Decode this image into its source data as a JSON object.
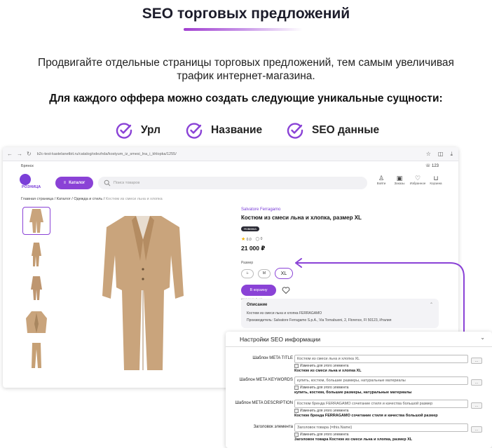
{
  "hero": {
    "title": "SEO торговых предложений",
    "subtitle": "Продвигайте отдельные страницы торговых предложений, тем самым увеличивая трафик интернет-магазина.",
    "heading": "Для каждого оффера можно создать следующие уникальные сущности:",
    "features": [
      {
        "label": "Урл",
        "icon": "check-circle-icon"
      },
      {
        "label": "Название",
        "icon": "check-circle-icon"
      },
      {
        "label": "SEO данные",
        "icon": "check-circle-icon"
      }
    ],
    "accent_color": "#8a42d6"
  },
  "browser": {
    "url": "b2c-test-kastelanetbit.ru/catalog/odezhda/kostyum_iz_smesi_lna_i_khlopka/1255/",
    "city": "Брянск",
    "phone": "☏ 123"
  },
  "store": {
    "logo_text": "РОЗНИЦА",
    "catalog_label": "Каталог",
    "search_placeholder": "Поиск товаров",
    "header_icons": [
      {
        "label": "Войти",
        "icon": "user-icon"
      },
      {
        "label": "Заказы",
        "icon": "box-icon"
      },
      {
        "label": "Избранное",
        "icon": "heart-icon"
      },
      {
        "label": "Корзина",
        "icon": "cart-icon"
      }
    ],
    "breadcrumbs": [
      "Главная страница",
      "Каталог",
      "Одежда и стиль"
    ],
    "breadcrumb_current": "Костюм из смеси льна и хлопка"
  },
  "product": {
    "brand": "Salvatore Ferragamo",
    "name": "Костюм из смеси льна и хлопка, размер XL",
    "badge": "Новинка",
    "rating": "0.0",
    "reviews": "0",
    "price": "21 000 ₽",
    "size_label": "Размер",
    "sizes": [
      "L",
      "M",
      "XL"
    ],
    "buy_label": "В корзину",
    "stock": "Наличие: 9 шт",
    "desc_title": "Описание",
    "desc_text": "Костюм из смеси льна и хлопка FERRAGAMO",
    "desc_maker": "Производитель: Salvatore Ferragamo S.p.A., Via Tornabuoni, 2, Florence, FI 50123, Италия",
    "suit_color": "#c9a47c"
  },
  "seo_panel": {
    "title": "Настройки SEO информации",
    "button_label": "...",
    "override_label": "Изменить для этого элемента",
    "fields": [
      {
        "label": "Шаблон META TITLE",
        "value": "Костюм из смеси льна и хлопка XL",
        "result": "Костюм из смеси льна и хлопка XL"
      },
      {
        "label": "Шаблон META KEYWORDS",
        "value": "купить, костюм, большие размеры, натуральные материалы",
        "result": "купить, костюм, большие размеры, натуральные материалы"
      },
      {
        "label": "Шаблон META DESCRIPTION",
        "value": "Костюм бренда FERRAGAMO сочетание стиля и качества большой размер",
        "result": "Костюм бренда FERRAGAMO сочетание стиля и качества большой размер"
      },
      {
        "label": "Заголовок элемента",
        "value": "Заголовок товара  {=this.Name}",
        "result": "Заголовок товара Костюм из смеси льна и хлопка, размер XL"
      }
    ]
  }
}
